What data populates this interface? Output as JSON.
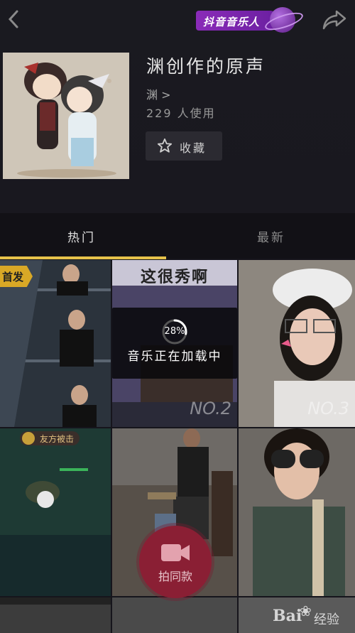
{
  "header": {
    "badge_text": "抖音音乐人",
    "title": "渊创作的原声",
    "author": "渊 >",
    "usage": "229 人使用",
    "favorite_label": "收藏"
  },
  "tabs": [
    {
      "label": "热门"
    },
    {
      "label": "最新"
    }
  ],
  "grid": {
    "first_tag": "首发",
    "video2_caption": "这很秀啊",
    "ranks": [
      "NO.2",
      "NO.3"
    ],
    "game_label": "友方被击"
  },
  "loading": {
    "percent_text": "28%",
    "progress": 0.28,
    "message": "音乐正在加载中"
  },
  "shoot_button": {
    "label": "拍同款"
  },
  "watermark": {
    "brand": "Bai",
    "suffix": "经验"
  },
  "colors": {
    "background": "#16151c",
    "tab_indicator": "#e6c24a",
    "badge_purple": "#8a2bb8",
    "shoot_red": "#8a1f34"
  }
}
